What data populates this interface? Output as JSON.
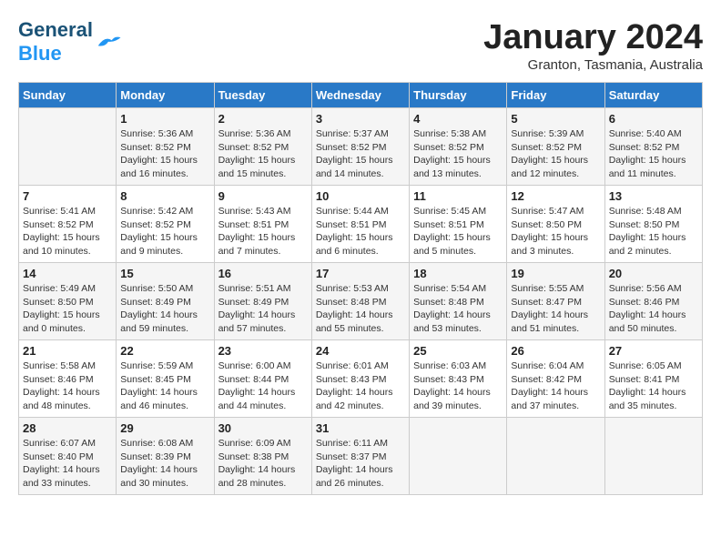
{
  "header": {
    "logo_general": "General",
    "logo_blue": "Blue",
    "month_title": "January 2024",
    "location": "Granton, Tasmania, Australia"
  },
  "calendar": {
    "days_of_week": [
      "Sunday",
      "Monday",
      "Tuesday",
      "Wednesday",
      "Thursday",
      "Friday",
      "Saturday"
    ],
    "weeks": [
      [
        {
          "day": "",
          "info": ""
        },
        {
          "day": "1",
          "info": "Sunrise: 5:36 AM\nSunset: 8:52 PM\nDaylight: 15 hours\nand 16 minutes."
        },
        {
          "day": "2",
          "info": "Sunrise: 5:36 AM\nSunset: 8:52 PM\nDaylight: 15 hours\nand 15 minutes."
        },
        {
          "day": "3",
          "info": "Sunrise: 5:37 AM\nSunset: 8:52 PM\nDaylight: 15 hours\nand 14 minutes."
        },
        {
          "day": "4",
          "info": "Sunrise: 5:38 AM\nSunset: 8:52 PM\nDaylight: 15 hours\nand 13 minutes."
        },
        {
          "day": "5",
          "info": "Sunrise: 5:39 AM\nSunset: 8:52 PM\nDaylight: 15 hours\nand 12 minutes."
        },
        {
          "day": "6",
          "info": "Sunrise: 5:40 AM\nSunset: 8:52 PM\nDaylight: 15 hours\nand 11 minutes."
        }
      ],
      [
        {
          "day": "7",
          "info": "Sunrise: 5:41 AM\nSunset: 8:52 PM\nDaylight: 15 hours\nand 10 minutes."
        },
        {
          "day": "8",
          "info": "Sunrise: 5:42 AM\nSunset: 8:52 PM\nDaylight: 15 hours\nand 9 minutes."
        },
        {
          "day": "9",
          "info": "Sunrise: 5:43 AM\nSunset: 8:51 PM\nDaylight: 15 hours\nand 7 minutes."
        },
        {
          "day": "10",
          "info": "Sunrise: 5:44 AM\nSunset: 8:51 PM\nDaylight: 15 hours\nand 6 minutes."
        },
        {
          "day": "11",
          "info": "Sunrise: 5:45 AM\nSunset: 8:51 PM\nDaylight: 15 hours\nand 5 minutes."
        },
        {
          "day": "12",
          "info": "Sunrise: 5:47 AM\nSunset: 8:50 PM\nDaylight: 15 hours\nand 3 minutes."
        },
        {
          "day": "13",
          "info": "Sunrise: 5:48 AM\nSunset: 8:50 PM\nDaylight: 15 hours\nand 2 minutes."
        }
      ],
      [
        {
          "day": "14",
          "info": "Sunrise: 5:49 AM\nSunset: 8:50 PM\nDaylight: 15 hours\nand 0 minutes."
        },
        {
          "day": "15",
          "info": "Sunrise: 5:50 AM\nSunset: 8:49 PM\nDaylight: 14 hours\nand 59 minutes."
        },
        {
          "day": "16",
          "info": "Sunrise: 5:51 AM\nSunset: 8:49 PM\nDaylight: 14 hours\nand 57 minutes."
        },
        {
          "day": "17",
          "info": "Sunrise: 5:53 AM\nSunset: 8:48 PM\nDaylight: 14 hours\nand 55 minutes."
        },
        {
          "day": "18",
          "info": "Sunrise: 5:54 AM\nSunset: 8:48 PM\nDaylight: 14 hours\nand 53 minutes."
        },
        {
          "day": "19",
          "info": "Sunrise: 5:55 AM\nSunset: 8:47 PM\nDaylight: 14 hours\nand 51 minutes."
        },
        {
          "day": "20",
          "info": "Sunrise: 5:56 AM\nSunset: 8:46 PM\nDaylight: 14 hours\nand 50 minutes."
        }
      ],
      [
        {
          "day": "21",
          "info": "Sunrise: 5:58 AM\nSunset: 8:46 PM\nDaylight: 14 hours\nand 48 minutes."
        },
        {
          "day": "22",
          "info": "Sunrise: 5:59 AM\nSunset: 8:45 PM\nDaylight: 14 hours\nand 46 minutes."
        },
        {
          "day": "23",
          "info": "Sunrise: 6:00 AM\nSunset: 8:44 PM\nDaylight: 14 hours\nand 44 minutes."
        },
        {
          "day": "24",
          "info": "Sunrise: 6:01 AM\nSunset: 8:43 PM\nDaylight: 14 hours\nand 42 minutes."
        },
        {
          "day": "25",
          "info": "Sunrise: 6:03 AM\nSunset: 8:43 PM\nDaylight: 14 hours\nand 39 minutes."
        },
        {
          "day": "26",
          "info": "Sunrise: 6:04 AM\nSunset: 8:42 PM\nDaylight: 14 hours\nand 37 minutes."
        },
        {
          "day": "27",
          "info": "Sunrise: 6:05 AM\nSunset: 8:41 PM\nDaylight: 14 hours\nand 35 minutes."
        }
      ],
      [
        {
          "day": "28",
          "info": "Sunrise: 6:07 AM\nSunset: 8:40 PM\nDaylight: 14 hours\nand 33 minutes."
        },
        {
          "day": "29",
          "info": "Sunrise: 6:08 AM\nSunset: 8:39 PM\nDaylight: 14 hours\nand 30 minutes."
        },
        {
          "day": "30",
          "info": "Sunrise: 6:09 AM\nSunset: 8:38 PM\nDaylight: 14 hours\nand 28 minutes."
        },
        {
          "day": "31",
          "info": "Sunrise: 6:11 AM\nSunset: 8:37 PM\nDaylight: 14 hours\nand 26 minutes."
        },
        {
          "day": "",
          "info": ""
        },
        {
          "day": "",
          "info": ""
        },
        {
          "day": "",
          "info": ""
        }
      ]
    ]
  }
}
